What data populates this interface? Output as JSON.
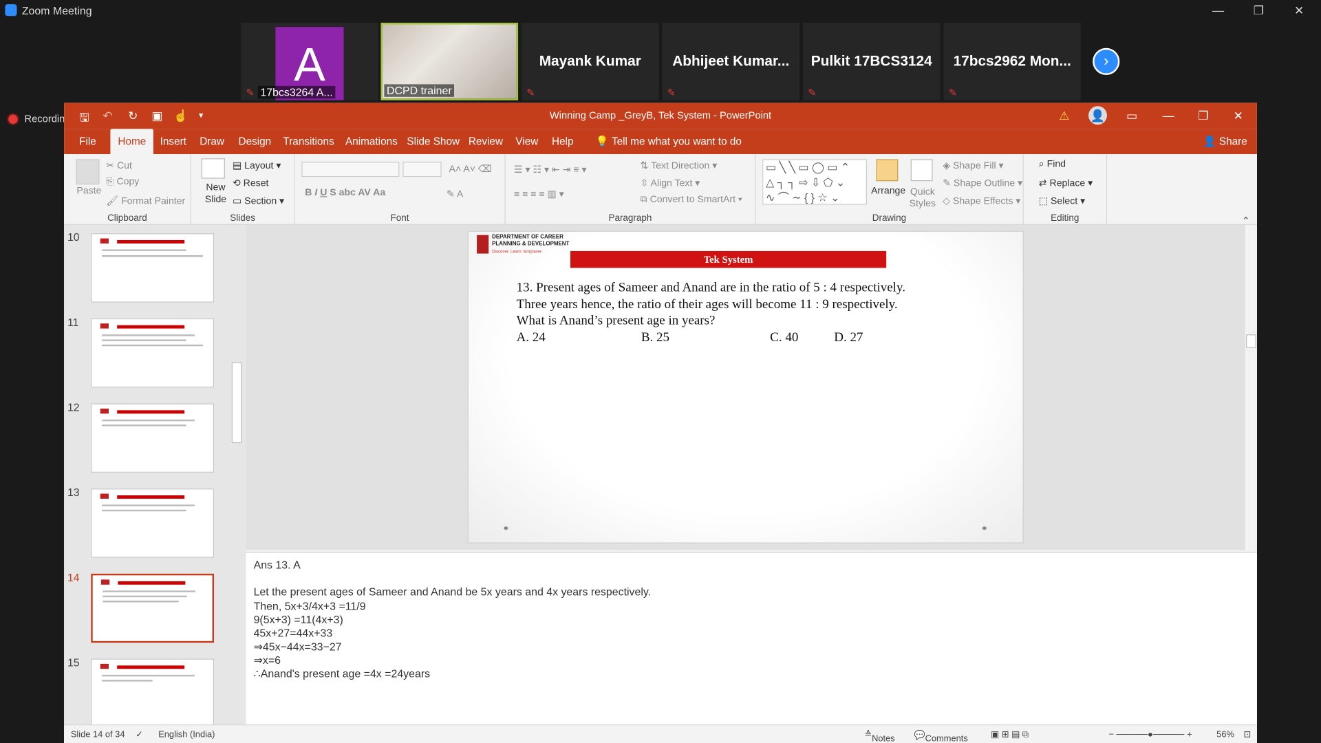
{
  "zoom": {
    "title": "Zoom Meeting",
    "recording": "Recording",
    "participants": [
      {
        "name": "A",
        "label": "17bcs3264 A..."
      },
      {
        "name": "",
        "label": "DCPD trainer"
      },
      {
        "name": "Mayank Kumar",
        "label": ""
      },
      {
        "name": "Abhijeet  Kumar...",
        "label": ""
      },
      {
        "name": "Pulkit 17BCS3124",
        "label": ""
      },
      {
        "name": "17bcs2962  Mon...",
        "label": ""
      }
    ]
  },
  "ppt": {
    "title": "Winning Camp _GreyB, Tek System  -  PowerPoint",
    "share": "Share",
    "tabs": [
      "File",
      "Home",
      "Insert",
      "Draw",
      "Design",
      "Transitions",
      "Animations",
      "Slide Show",
      "Review",
      "View",
      "Help"
    ],
    "tell": "Tell me what you want to do",
    "ribbon": {
      "clipboard": {
        "label": "Clipboard",
        "paste": "Paste",
        "cut": "Cut",
        "copy": "Copy",
        "format_painter": "Format Painter"
      },
      "slides": {
        "label": "Slides",
        "new_slide": "New Slide",
        "layout": "Layout",
        "reset": "Reset",
        "section": "Section"
      },
      "font": {
        "label": "Font"
      },
      "paragraph": {
        "label": "Paragraph",
        "text_direction": "Text Direction",
        "align_text": "Align Text",
        "convert": "Convert to SmartArt"
      },
      "drawing": {
        "label": "Drawing",
        "arrange": "Arrange",
        "quick_styles": "Quick Styles",
        "shape_fill": "Shape Fill",
        "shape_outline": "Shape Outline",
        "shape_effects": "Shape Effects"
      },
      "editing": {
        "label": "Editing",
        "find": "Find",
        "replace": "Replace",
        "select": "Select"
      }
    },
    "thumbs": [
      {
        "num": "10"
      },
      {
        "num": "11"
      },
      {
        "num": "12"
      },
      {
        "num": "13"
      },
      {
        "num": "14",
        "selected": true
      },
      {
        "num": "15"
      }
    ],
    "slide": {
      "dept": "DEPARTMENT OF CAREER\nPLANNING & DEVELOPMENT",
      "dept_sub": "Discover. Learn. Empower.",
      "banner": "Tek System",
      "q1": "13. Present ages of Sameer and Anand are in the ratio of 5 : 4 respectively.",
      "q2": "Three years hence, the ratio of their ages will become 11 : 9 respectively.",
      "q3": "What is Anand’s present age in years?",
      "options": [
        "A. 24",
        "B. 25",
        "C. 40",
        "D. 27"
      ]
    },
    "notes": [
      "Ans 13. A",
      "",
      "Let the present ages of Sameer and Anand be 5x years and 4x years respectively.",
      "Then, 5x+3/4x+3 =11/9",
      "9(5x+3) =11(4x+3)",
      "45x+27=44x+33",
      "⇒45x−44x=33−27",
      "⇒x=6",
      "∴Anand's present age =4x =24years"
    ],
    "status": {
      "slide": "Slide 14 of 34",
      "lang": "English (India)",
      "notes": "Notes",
      "comments": "Comments",
      "zoom": "56%"
    }
  }
}
